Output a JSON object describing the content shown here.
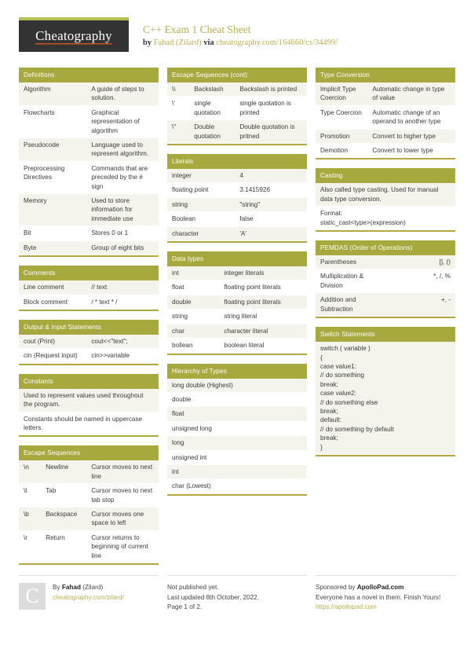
{
  "header": {
    "logo_text": "Cheatography",
    "title": "C++ Exam 1 Cheat Sheet",
    "by_label": "by",
    "author": "Fahad (Zilard)",
    "via_label": "via",
    "url": "cheatography.com/164660/cs/34499/"
  },
  "sections": {
    "definitions": {
      "title": "Definitions",
      "rows": [
        {
          "key": "Algorithm",
          "val": "A guide of steps to solution."
        },
        {
          "key": "Flowcharts",
          "val": "Graphical representation of algorithm"
        },
        {
          "key": "Pseudocode",
          "val": "Language used to represent algorithm."
        },
        {
          "key": "Preprocessing Directives",
          "val": "Commands that are preceded by the # sign"
        },
        {
          "key": "Memory",
          "val": "Used to store information for immediate use"
        },
        {
          "key": "Bit",
          "val": "Stores 0 or 1"
        },
        {
          "key": "Byte",
          "val": "Group of eight bits"
        }
      ]
    },
    "comments": {
      "title": "Comments",
      "rows": [
        {
          "key": "Line comment",
          "val": "// text"
        },
        {
          "key": "Block comment",
          "val": "/ * text * /"
        }
      ]
    },
    "output_input": {
      "title": "Output & Input Statements",
      "rows": [
        {
          "key": "cout (Print)",
          "val": "cout<<\"text\";"
        },
        {
          "key": "cin (Request input)",
          "val": "cin>>variable"
        }
      ]
    },
    "constants": {
      "title": "Constants",
      "rows": [
        {
          "text": "Used to represent values used throughout the program."
        },
        {
          "text": "Constants should be named in uppercase letters."
        }
      ]
    },
    "escape_sequences": {
      "title": "Escape Sequences",
      "rows": [
        {
          "esc": "\\n",
          "name": "Newline",
          "desc": "Cursor moves to next line"
        },
        {
          "esc": "\\t",
          "name": "Tab",
          "desc": "Cursor moves to next tab stop"
        },
        {
          "esc": "\\b",
          "name": "Backspace",
          "desc": "Cursor moves one space to left"
        },
        {
          "esc": "\\r",
          "name": "Return",
          "desc": "Cursor returns to beginning of current line"
        }
      ]
    },
    "escape_sequences_cont": {
      "title": "Escape Sequences (cont)",
      "rows": [
        {
          "esc": "\\\\",
          "name": "Backslash",
          "desc": "Backslash is printed"
        },
        {
          "esc": "\\'",
          "name": "single quotation",
          "desc": "single quotation is printed"
        },
        {
          "esc": "\\\"",
          "name": "Double quotation",
          "desc": "Double quotation is pritned"
        }
      ]
    },
    "literals": {
      "title": "Literals",
      "rows": [
        {
          "key": "integer",
          "val": "4"
        },
        {
          "key": "floating point",
          "val": "3.1415926"
        },
        {
          "key": "string",
          "val": "\"string\""
        },
        {
          "key": "Boolean",
          "val": "false"
        },
        {
          "key": "character",
          "val": "'A'"
        }
      ]
    },
    "data_types": {
      "title": "Data types",
      "rows": [
        {
          "key": "int",
          "val": "integer literals"
        },
        {
          "key": "float",
          "val": "floating point literals"
        },
        {
          "key": "double",
          "val": "floating point literals"
        },
        {
          "key": "string",
          "val": "string literal"
        },
        {
          "key": "char",
          "val": "character literal"
        },
        {
          "key": "bollean",
          "val": "boolean literal"
        }
      ]
    },
    "hierarchy_of_types": {
      "title": "Hierarchy of Types",
      "rows": [
        {
          "text": "long double (Highest)"
        },
        {
          "text": "double"
        },
        {
          "text": "float"
        },
        {
          "text": "unsigned long"
        },
        {
          "text": "long"
        },
        {
          "text": "unsigned int"
        },
        {
          "text": "int"
        },
        {
          "text": "char (Lowest)"
        }
      ]
    },
    "type_conversion": {
      "title": "Type Conversion",
      "rows": [
        {
          "key": "Implicit Type Coercion",
          "val": "Automatic change in type of value"
        },
        {
          "key": "Type Coercion",
          "val": "Automatic change of an operand to another type"
        },
        {
          "key": "Promotion",
          "val": "Convert to higher type"
        },
        {
          "key": "Demotion",
          "val": "Convert to lower type"
        }
      ]
    },
    "casting": {
      "title": "Casting",
      "rows": [
        {
          "text": "Also called type casting. Used for manual data type conversion."
        },
        {
          "text": "Format:\nstatic_cast<type>(expression)"
        }
      ]
    },
    "pemdas": {
      "title": "PEMDAS (Order of Operations)",
      "rows": [
        {
          "key": "Parentheses",
          "val": "[], ()"
        },
        {
          "key": "Multiplication & Division",
          "val": "*, /, %"
        },
        {
          "key": "Addition and Subtraction",
          "val": "+, -"
        }
      ]
    },
    "switch_statements": {
      "title": "Switch Statements",
      "code": "switch ( variable )\n{\ncase value1:\n// do something\nbreak;\ncase value2:\n// do something else\nbreak;\ndefault:\n// do something by default\nbreak;\n}"
    }
  },
  "footer": {
    "avatar_letter": "C",
    "by_label": "By ",
    "author_name": "Fahad",
    "author_suffix": " (Zilard)",
    "author_url": "cheatography.com/zilard/",
    "publish_status": "Not published yet.",
    "last_updated": "Last updated 8th October, 2022.",
    "page_number": "Page 1 of 2.",
    "sponsor_prefix": "Sponsored by ",
    "sponsor_name": "ApolloPad.com",
    "sponsor_tagline": "Everyone has a novel in them. Finish Yours!",
    "sponsor_url": "https://apollopad.com"
  },
  "colors": {
    "header_olive": "#a7a93f",
    "accent_underline": "#b4a83d",
    "title_gold": "#b9ac54",
    "logo_dark": "#333333",
    "logo_orange": "#c4561e",
    "row_alt": "#f4f4ec"
  }
}
